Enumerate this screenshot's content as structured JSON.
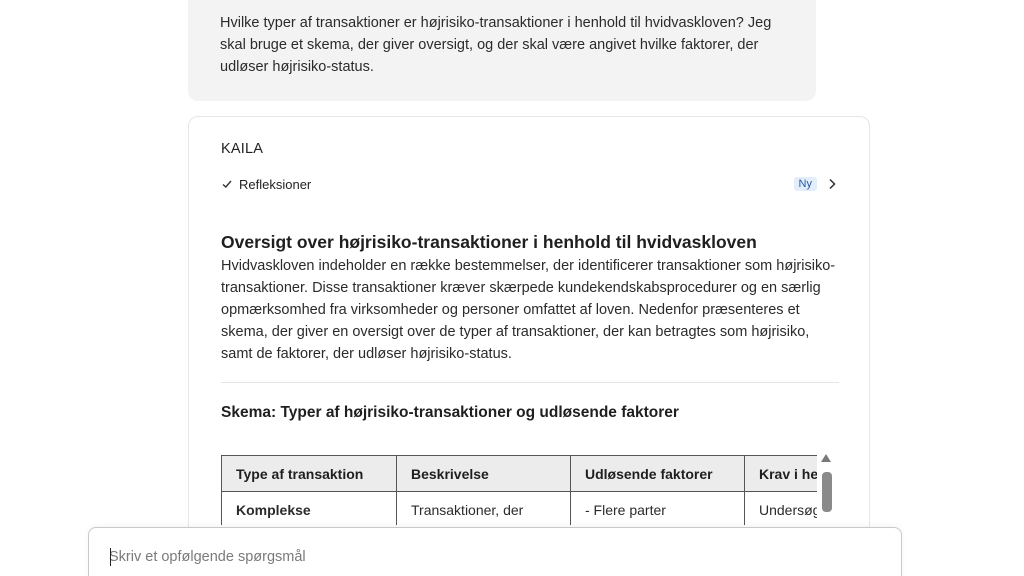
{
  "user_message": {
    "text": "Hvilke typer af transaktioner er højrisiko-transaktioner i henhold til hvidvaskloven? Jeg skal bruge et skema, der giver oversigt, og der skal være angivet hvilke faktorer, der udløser højrisiko-status."
  },
  "answer": {
    "assistant_name": "KAILA",
    "reflections_label": "Refleksioner",
    "new_badge": "Ny",
    "heading": "Oversigt over højrisiko-transaktioner i henhold til hvidvaskloven",
    "body": "Hvidvaskloven indeholder en række bestemmelser, der identificerer transaktioner som højrisiko-transaktioner. Disse transaktioner kræver skærpede kundekendskabsprocedurer og en særlig opmærksomhed fra virksomheder og personer omfattet af loven. Nedenfor præsenteres et skema, der giver en oversigt over de typer af transaktioner, der kan betragtes som højrisiko, samt de faktorer, der udløser højrisiko-status.",
    "schema_heading": "Skema: Typer af højrisiko-transaktioner og udløsende faktorer",
    "table": {
      "headers": [
        "Type af transaktion",
        "Beskrivelse",
        "Udløsende faktorer",
        "Krav i henhold"
      ],
      "row1": [
        "Komplekse",
        "Transaktioner, der",
        "- Flere parter",
        "Undersøg"
      ]
    }
  },
  "followup": {
    "placeholder": "Skriv et opfølgende spørgsmål",
    "value": ""
  },
  "icons": {
    "check": "check-icon",
    "chevron": "chevron-right-icon",
    "scroll_up": "scroll-up-icon"
  },
  "colors": {
    "user_bubble_bg": "#f3f3f3",
    "badge_bg": "#e3eefb",
    "badge_text": "#2c5aa0",
    "table_header_bg": "#ececec"
  }
}
